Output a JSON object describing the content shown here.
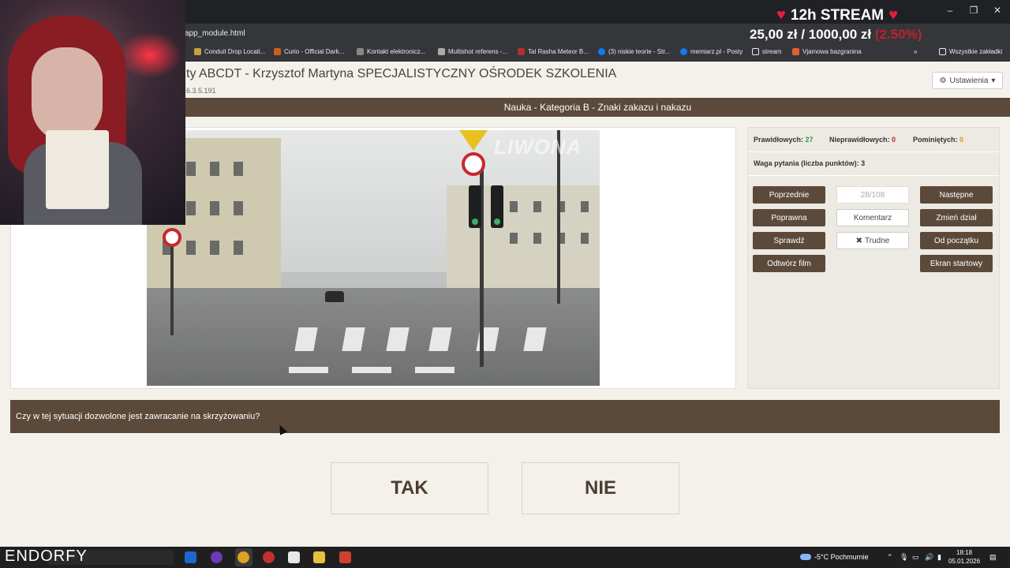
{
  "browser": {
    "url": "app_module.html",
    "window_controls": [
      "–",
      "❐",
      "✕"
    ],
    "bookmarks": [
      {
        "label": "Conduit Drop Locati...",
        "color": "#c8a040"
      },
      {
        "label": "Curio - Official Dark...",
        "color": "#c86020"
      },
      {
        "label": "Kontakt elektronicz...",
        "color": "#888888"
      },
      {
        "label": "Multishot referens -...",
        "color": "#aaaaaa"
      },
      {
        "label": "Tal Rasha Meteor B...",
        "color": "#b03030"
      },
      {
        "label": "(3) niskie teorie - Str...",
        "color": "#1877f2"
      },
      {
        "label": "memiarz.pl - Posty",
        "color": "#1877f2"
      },
      {
        "label": "stream",
        "color": "#e8eaed"
      },
      {
        "label": "Vjamowa bazgranina",
        "color": "#e06030"
      }
    ],
    "more_bookmarks": "»",
    "all_bookmarks": "Wszystkie zakładki"
  },
  "stream_overlay": {
    "title": "12h STREAM",
    "goal_current": "25,00 zł",
    "goal_separator": "/",
    "goal_target": "1000,00 zł",
    "goal_percent": "(2.50%)"
  },
  "app": {
    "title": "ty ABCDT - Krzysztof Martyna SPECJALISTYCZNY OŚRODEK SZKOLENIA",
    "version": "6.3.5.191",
    "settings_label": "Ustawienia",
    "banner": "Nauka - Kategoria B - Znaki zakazu i nakazu"
  },
  "video": {
    "watermark": "LIWONA"
  },
  "stats": {
    "correct_label": "Prawidłowych:",
    "correct_value": "27",
    "incorrect_label": "Nieprawidłowych:",
    "incorrect_value": "0",
    "skipped_label": "Pominiętych:",
    "skipped_value": "0",
    "weight_label": "Waga pytania (liczba punktów): 3"
  },
  "controls": {
    "previous": "Poprzednie",
    "counter": "28/108",
    "next": "Następne",
    "correct": "Poprawna",
    "comment": "Komentarz",
    "change_section": "Zmień dział",
    "check": "Sprawdź",
    "difficult": "Trudne",
    "from_start": "Od początku",
    "play_film": "Odtwórz film",
    "start_screen": "Ekran startowy"
  },
  "question": "Czy w tej sytuacji dozwolone jest zawracanie na skrzyżowaniu?",
  "answers": {
    "yes": "TAK",
    "no": "NIE"
  },
  "taskbar": {
    "brand": "ENDORFY",
    "weather": "-5°C Pochmurnie",
    "time": "18:18",
    "date": "05.01.2026"
  },
  "colors": {
    "brand_brown": "#5b4a3a",
    "correct_green": "#2d9a4a",
    "incorrect_red": "#c0202a",
    "skipped_yellow": "#d4a200"
  }
}
